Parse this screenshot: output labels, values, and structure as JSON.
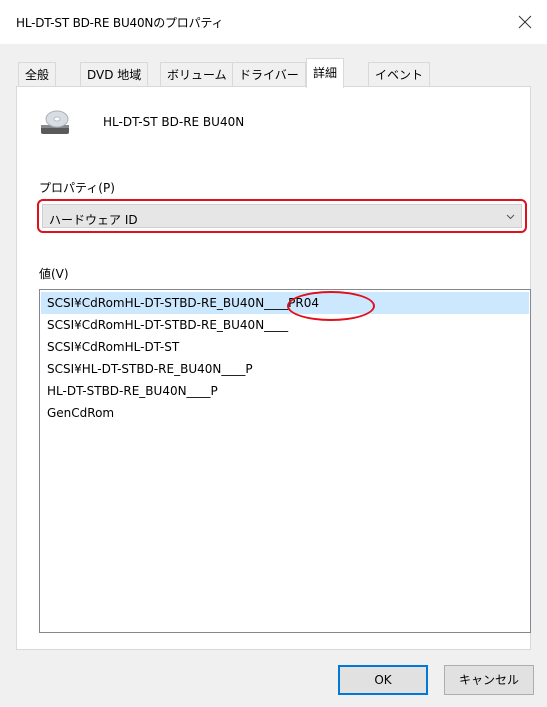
{
  "window": {
    "title": "HL-DT-ST BD-RE BU40Nのプロパティ"
  },
  "tabs": [
    {
      "label": "全般"
    },
    {
      "label": "DVD 地域"
    },
    {
      "label": "ボリューム"
    },
    {
      "label": "ドライバー"
    },
    {
      "label": "詳細",
      "active": true
    },
    {
      "label": "イベント"
    }
  ],
  "device": {
    "name": "HL-DT-ST BD-RE BU40N",
    "icon": "optical-drive-icon"
  },
  "property": {
    "label": "プロパティ(P)",
    "selected": "ハードウェア ID"
  },
  "value": {
    "label": "値(V)",
    "items": [
      "SCSI¥CdRomHL-DT-STBD-RE_BU40N____PR04",
      "SCSI¥CdRomHL-DT-STBD-RE_BU40N____",
      "SCSI¥CdRomHL-DT-ST",
      "SCSI¥HL-DT-STBD-RE_BU40N____P",
      "HL-DT-STBD-RE_BU40N____P",
      "GenCdRom"
    ],
    "selected_index": 0
  },
  "buttons": {
    "ok": "OK",
    "cancel": "キャンセル"
  },
  "colors": {
    "highlight": "#e0101c",
    "selection": "#cce8ff",
    "focus": "#0078d7"
  }
}
